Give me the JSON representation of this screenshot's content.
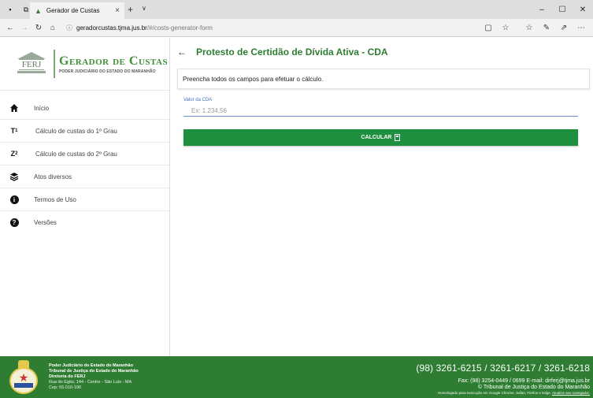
{
  "browser": {
    "tab_title": "Gerador de Custas",
    "url_host": "geradorcustas.tjma.jus.br",
    "url_path": "/#/costs-generator-form"
  },
  "sidebar": {
    "brand_logo_text": "FERJ",
    "brand_title": "Gerador de Custas",
    "brand_subtitle": "PODER JUDICIÁRIO DO ESTADO DO MARANHÃO",
    "items": [
      {
        "label": "Início",
        "icon": "home-icon",
        "glyph": "🏠"
      },
      {
        "label": "Cálculo de custas do 1º Grau",
        "icon": "first-degree-icon",
        "glyph": "T₁"
      },
      {
        "label": "Cálculo de custas do 2º Grau",
        "icon": "second-degree-icon",
        "glyph": "Z₂"
      },
      {
        "label": "Atos diversos",
        "icon": "layers-icon",
        "glyph": "≋"
      },
      {
        "label": "Termos de Uso",
        "icon": "info-icon",
        "glyph": "i"
      },
      {
        "label": "Versões",
        "icon": "help-icon",
        "glyph": "?"
      }
    ]
  },
  "main": {
    "title": "Protesto de Certidão de Dívida Ativa - CDA",
    "instruction": "Preencha todos os campos para efetuar o cálculo.",
    "field_label": "Valor da CDA",
    "field_placeholder": "Ex: 1.234,56",
    "button_label": "CALCULAR"
  },
  "footer": {
    "org_line1": "Poder Judiciário do Estado do Maranhão",
    "org_line2": "Tribunal de Justiça do Estado do Maranhão",
    "org_line3": "Diretoria do FERJ",
    "address": "Rua do Egito, 144 - Centro - São Luís - MA",
    "cep": "Cep: 65.010-190",
    "phones": "(98) 3261-6215 / 3261-6217 / 3261-6218",
    "fax": "Fax: (98) 3254-0449 / 0699 E-mail: dirferj@tjma.jus.br",
    "copyright": "© Tribunal de Justiça do Estado do Maranhão",
    "homolog": "Homologado para execução em Google Chrome, Safari, Firefox e Edge.",
    "homolog_link": "Atualize seu navegador."
  },
  "colors": {
    "brand_green": "#2e7d32",
    "button_green": "#1e8f3e",
    "input_blue": "#6d8fd1"
  }
}
